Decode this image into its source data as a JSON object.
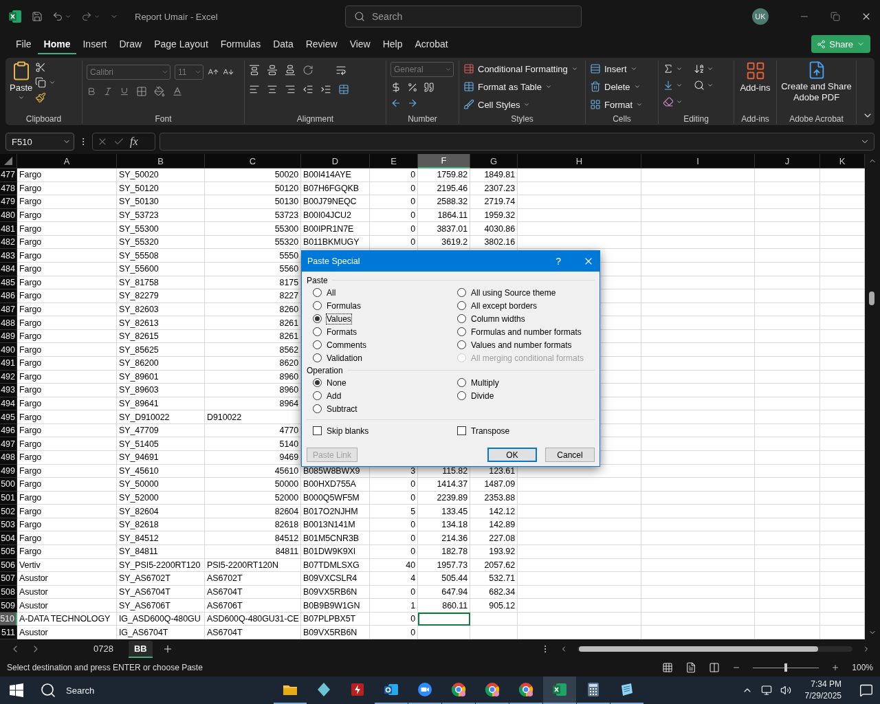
{
  "title_bar": {
    "document_title": "Report Umair - Excel",
    "search_placeholder": "Search",
    "user_initials": "UK"
  },
  "menu_tabs": [
    {
      "label": "File",
      "selected": false
    },
    {
      "label": "Home",
      "selected": true
    },
    {
      "label": "Insert",
      "selected": false
    },
    {
      "label": "Draw",
      "selected": false
    },
    {
      "label": "Page Layout",
      "selected": false
    },
    {
      "label": "Formulas",
      "selected": false
    },
    {
      "label": "Data",
      "selected": false
    },
    {
      "label": "Review",
      "selected": false
    },
    {
      "label": "View",
      "selected": false
    },
    {
      "label": "Help",
      "selected": false
    },
    {
      "label": "Acrobat",
      "selected": false
    }
  ],
  "share_button": "Share",
  "ribbon": {
    "clipboard": {
      "label": "Clipboard",
      "paste": "Paste"
    },
    "font": {
      "label": "Font",
      "font_name": "Calibri",
      "font_size": "11",
      "disabled": true
    },
    "alignment": {
      "label": "Alignment"
    },
    "number": {
      "label": "Number",
      "format": "General",
      "disabled": true
    },
    "styles": {
      "label": "Styles",
      "buttons": [
        "Conditional Formatting",
        "Format as Table",
        "Cell Styles"
      ]
    },
    "cells": {
      "label": "Cells",
      "buttons": [
        "Insert",
        "Delete",
        "Format"
      ]
    },
    "editing": {
      "label": "Editing"
    },
    "add_ins": {
      "label": "Add-ins",
      "button": "Add-ins"
    },
    "acrobat": {
      "label": "Adobe Acrobat",
      "button": "Create and Share Adobe PDF"
    }
  },
  "formula_bar": {
    "name_box": "F510",
    "fx": "fx"
  },
  "columns": [
    {
      "label": "A",
      "selected": false
    },
    {
      "label": "B",
      "selected": false
    },
    {
      "label": "C",
      "selected": false
    },
    {
      "label": "D",
      "selected": false
    },
    {
      "label": "E",
      "selected": false
    },
    {
      "label": "F",
      "selected": true
    },
    {
      "label": "G",
      "selected": false
    },
    {
      "label": "H",
      "selected": false
    },
    {
      "label": "I",
      "selected": false
    },
    {
      "label": "J",
      "selected": false
    },
    {
      "label": "K",
      "selected": false
    }
  ],
  "rows": [
    {
      "number": "477",
      "selected": false,
      "cells": [
        "Fargo",
        "SY_50020",
        "50020",
        "B00I414AYE",
        "0",
        "1759.82",
        "1849.81"
      ]
    },
    {
      "number": "478",
      "selected": false,
      "cells": [
        "Fargo",
        "SY_50120",
        "50120",
        "B07H6FGQKB",
        "0",
        "2195.46",
        "2307.23"
      ]
    },
    {
      "number": "479",
      "selected": false,
      "cells": [
        "Fargo",
        "SY_50130",
        "50130",
        "B00J79NEQC",
        "0",
        "2588.32",
        "2719.74"
      ]
    },
    {
      "number": "480",
      "selected": false,
      "cells": [
        "Fargo",
        "SY_53723",
        "53723",
        "B00I04JCU2",
        "0",
        "1864.11",
        "1959.32"
      ]
    },
    {
      "number": "481",
      "selected": false,
      "cells": [
        "Fargo",
        "SY_55300",
        "55300",
        "B00IPR1N7E",
        "0",
        "3837.01",
        "4030.86"
      ]
    },
    {
      "number": "482",
      "selected": false,
      "cells": [
        "Fargo",
        "SY_55320",
        "55320",
        "B011BKMUGY",
        "0",
        "3619.2",
        "3802.16"
      ]
    },
    {
      "number": "483",
      "selected": false,
      "cells": [
        "Fargo",
        "SY_55508",
        "5550"
      ]
    },
    {
      "number": "484",
      "selected": false,
      "cells": [
        "Fargo",
        "SY_55600",
        "5560"
      ]
    },
    {
      "number": "485",
      "selected": false,
      "cells": [
        "Fargo",
        "SY_81758",
        "8175"
      ]
    },
    {
      "number": "486",
      "selected": false,
      "cells": [
        "Fargo",
        "SY_82279",
        "8227"
      ]
    },
    {
      "number": "487",
      "selected": false,
      "cells": [
        "Fargo",
        "SY_82603",
        "8260"
      ]
    },
    {
      "number": "488",
      "selected": false,
      "cells": [
        "Fargo",
        "SY_82613",
        "8261"
      ]
    },
    {
      "number": "489",
      "selected": false,
      "cells": [
        "Fargo",
        "SY_82615",
        "8261"
      ]
    },
    {
      "number": "490",
      "selected": false,
      "cells": [
        "Fargo",
        "SY_85625",
        "8562"
      ]
    },
    {
      "number": "491",
      "selected": false,
      "cells": [
        "Fargo",
        "SY_86200",
        "8620"
      ]
    },
    {
      "number": "492",
      "selected": false,
      "cells": [
        "Fargo",
        "SY_89601",
        "8960"
      ]
    },
    {
      "number": "493",
      "selected": false,
      "cells": [
        "Fargo",
        "SY_89603",
        "8960"
      ]
    },
    {
      "number": "494",
      "selected": false,
      "cells": [
        "Fargo",
        "SY_89641",
        "8964"
      ]
    },
    {
      "number": "495",
      "selected": false,
      "cells": [
        "Fargo",
        "SY_D910022",
        "D910022"
      ]
    },
    {
      "number": "496",
      "selected": false,
      "cells": [
        "Fargo",
        "SY_47709",
        "4770"
      ]
    },
    {
      "number": "497",
      "selected": false,
      "cells": [
        "Fargo",
        "SY_51405",
        "5140"
      ]
    },
    {
      "number": "498",
      "selected": false,
      "cells": [
        "Fargo",
        "SY_94691",
        "9469"
      ]
    },
    {
      "number": "499",
      "selected": false,
      "cells": [
        "Fargo",
        "SY_45610",
        "45610",
        "B085W8BWX9",
        "3",
        "115.82",
        "123.61"
      ]
    },
    {
      "number": "500",
      "selected": false,
      "cells": [
        "Fargo",
        "SY_50000",
        "50000",
        "B00HXD755A",
        "0",
        "1414.37",
        "1487.09"
      ]
    },
    {
      "number": "501",
      "selected": false,
      "cells": [
        "Fargo",
        "SY_52000",
        "52000",
        "B000Q5WF5M",
        "0",
        "2239.89",
        "2353.88"
      ]
    },
    {
      "number": "502",
      "selected": false,
      "cells": [
        "Fargo",
        "SY_82604",
        "82604",
        "B017O2NJHM",
        "5",
        "133.45",
        "142.12"
      ]
    },
    {
      "number": "503",
      "selected": false,
      "cells": [
        "Fargo",
        "SY_82618",
        "82618",
        "B0013N141M",
        "0",
        "134.18",
        "142.89"
      ]
    },
    {
      "number": "504",
      "selected": false,
      "cells": [
        "Fargo",
        "SY_84512",
        "84512",
        "B01M5CNR3B",
        "0",
        "214.36",
        "227.08"
      ]
    },
    {
      "number": "505",
      "selected": false,
      "cells": [
        "Fargo",
        "SY_84811",
        "84811",
        "B01DW9K9XI",
        "0",
        "182.78",
        "193.92"
      ]
    },
    {
      "number": "506",
      "selected": false,
      "cells": [
        "Vertiv",
        "SY_PSI5-2200RT120",
        "PSI5-2200RT120N",
        "B07TDMLSXG",
        "40",
        "1957.73",
        "2057.62"
      ]
    },
    {
      "number": "507",
      "selected": false,
      "cells": [
        "Asustor",
        "SY_AS6702T",
        "AS6702T",
        "B09VXCSLR4",
        "4",
        "505.44",
        "532.71"
      ]
    },
    {
      "number": "508",
      "selected": false,
      "cells": [
        "Asustor",
        "SY_AS6704T",
        "AS6704T",
        "B09VX5RB6N",
        "0",
        "647.94",
        "682.34"
      ]
    },
    {
      "number": "509",
      "selected": false,
      "cells": [
        "Asustor",
        "SY_AS6706T",
        "AS6706T",
        "B0B9B9W1GN",
        "1",
        "860.11",
        "905.12"
      ]
    },
    {
      "number": "510",
      "selected": true,
      "cells": [
        "A-DATA TECHNOLOGY",
        "IG_ASD600Q-480GU",
        "ASD600Q-480GU31-CE",
        "B07PLPBX5T",
        "0"
      ]
    },
    {
      "number": "511",
      "selected": false,
      "cells": [
        "Asustor",
        "IG_AS6704T",
        "AS6704T",
        "B09VX5RB6N",
        "0"
      ]
    }
  ],
  "paste_special": {
    "title": "Paste Special",
    "help": "?",
    "paste_label": "Paste",
    "paste_options": [
      {
        "label": "All",
        "selected": false,
        "disabled": false
      },
      {
        "label": "Formulas",
        "selected": false,
        "disabled": false
      },
      {
        "label": "Values",
        "selected": true,
        "disabled": false
      },
      {
        "label": "Formats",
        "selected": false,
        "disabled": false
      },
      {
        "label": "Comments",
        "selected": false,
        "disabled": false
      },
      {
        "label": "Validation",
        "selected": false,
        "disabled": false
      },
      {
        "label": "All using Source theme",
        "selected": false,
        "disabled": false
      },
      {
        "label": "All except borders",
        "selected": false,
        "disabled": false
      },
      {
        "label": "Column widths",
        "selected": false,
        "disabled": false
      },
      {
        "label": "Formulas and number formats",
        "selected": false,
        "disabled": false
      },
      {
        "label": "Values and number formats",
        "selected": false,
        "disabled": false
      },
      {
        "label": "All merging conditional formats",
        "selected": false,
        "disabled": true
      }
    ],
    "operation_label": "Operation",
    "operation_options": [
      {
        "label": "None",
        "selected": true
      },
      {
        "label": "Add",
        "selected": false
      },
      {
        "label": "Subtract",
        "selected": false
      },
      {
        "label": "Multiply",
        "selected": false
      },
      {
        "label": "Divide",
        "selected": false
      }
    ],
    "checkboxes": [
      {
        "label": "Skip blanks",
        "checked": false
      },
      {
        "label": "Transpose",
        "checked": false
      }
    ],
    "buttons": [
      {
        "label": "Paste Link",
        "disabled": true,
        "default": false
      },
      {
        "label": "OK",
        "disabled": false,
        "default": true
      },
      {
        "label": "Cancel",
        "disabled": false,
        "default": false
      }
    ]
  },
  "sheet_tabs": [
    {
      "label": "0728",
      "selected": false
    },
    {
      "label": "BB",
      "selected": true
    }
  ],
  "status_bar": {
    "message": "Select destination and press ENTER or choose Paste",
    "zoom": {
      "level": 0.5,
      "reading": "100%"
    }
  },
  "taskbar": {
    "search": "Search",
    "time": "7:34 PM",
    "date": "7/29/2025"
  }
}
